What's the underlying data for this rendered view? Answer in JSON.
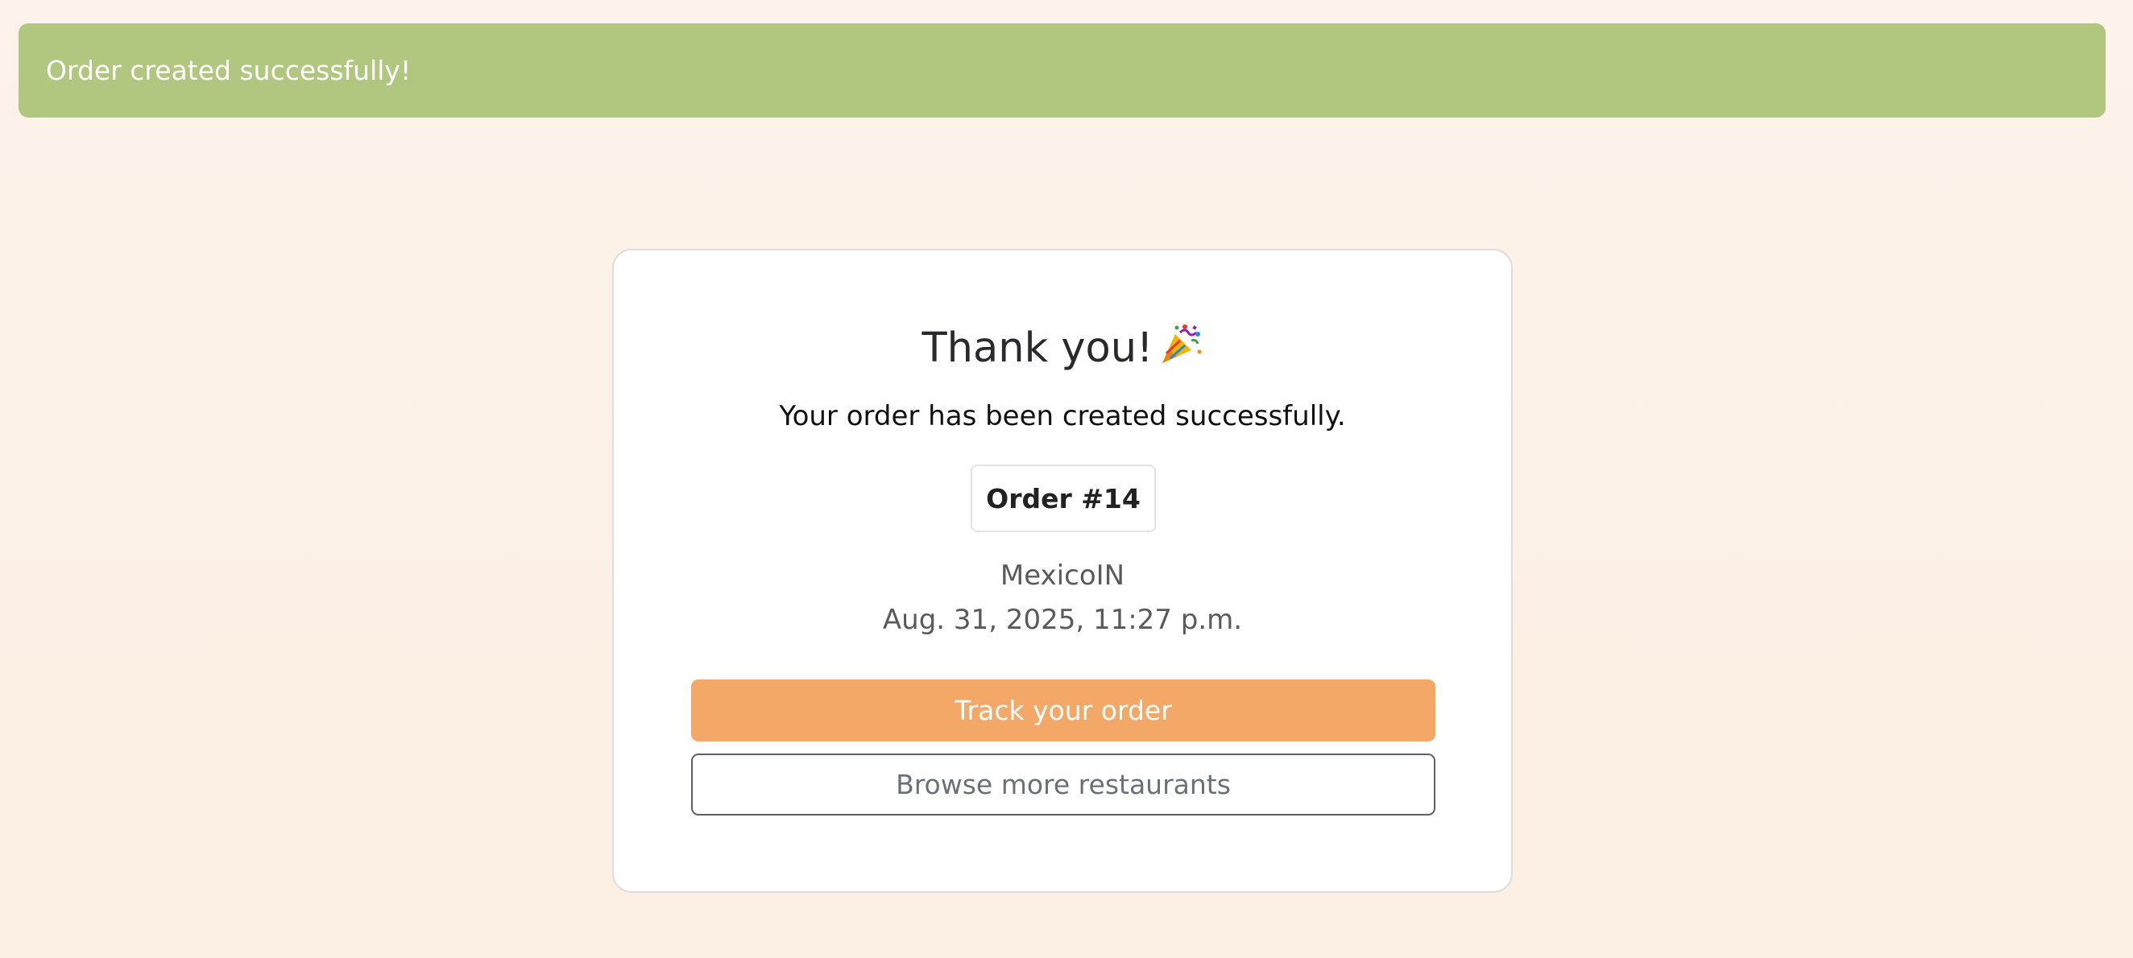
{
  "alert": {
    "message": "Order created successfully!",
    "color": "#b1c67e"
  },
  "card": {
    "title": "Thank you!",
    "title_icon": "party-popper-icon",
    "subtitle": "Your order has been created successfully.",
    "order_label": "Order #14",
    "restaurant": "MexicoIN",
    "datetime": "Aug. 31, 2025, 11:27 p.m."
  },
  "actions": {
    "track_label": "Track your order",
    "browse_label": "Browse more restaurants"
  },
  "colors": {
    "accent": "#f3a868",
    "success": "#b1c67e",
    "background": "#fdf3ea"
  }
}
